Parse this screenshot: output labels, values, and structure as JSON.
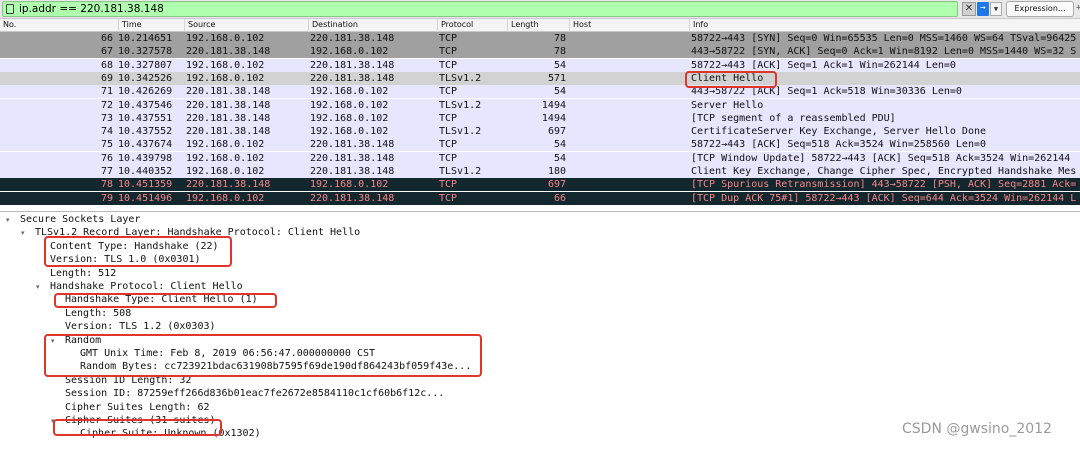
{
  "filter": {
    "value": "ip.addr == 220.181.38.148",
    "expression_label": "Expression...",
    "plus_label": "+"
  },
  "columns": [
    "No.",
    "Time",
    "Source",
    "Destination",
    "Protocol",
    "Length",
    "Host",
    "Info"
  ],
  "packets": [
    {
      "no": "66",
      "time": "10.214651",
      "src": "192.168.0.102",
      "dst": "220.181.38.148",
      "proto": "TCP",
      "len": "78",
      "host": "",
      "info": "58722→443 [SYN] Seq=0 Win=65535 Len=0 MSS=1460 WS=64 TSval=96425",
      "style": "gray"
    },
    {
      "no": "67",
      "time": "10.327578",
      "src": "220.181.38.148",
      "dst": "192.168.0.102",
      "proto": "TCP",
      "len": "78",
      "host": "",
      "info": "443→58722 [SYN, ACK] Seq=0 Ack=1 Win=8192 Len=0 MSS=1440 WS=32 S",
      "style": "gray"
    },
    {
      "no": "68",
      "time": "10.327807",
      "src": "192.168.0.102",
      "dst": "220.181.38.148",
      "proto": "TCP",
      "len": "54",
      "host": "",
      "info": "58722→443 [ACK] Seq=1 Ack=1 Win=262144 Len=0",
      "style": "lav"
    },
    {
      "no": "69",
      "time": "10.342526",
      "src": "192.168.0.102",
      "dst": "220.181.38.148",
      "proto": "TLSv1.2",
      "len": "571",
      "host": "",
      "info": "Client Hello",
      "style": "sel"
    },
    {
      "no": "71",
      "time": "10.426269",
      "src": "220.181.38.148",
      "dst": "192.168.0.102",
      "proto": "TCP",
      "len": "54",
      "host": "",
      "info": "443→58722 [ACK] Seq=1 Ack=518 Win=30336 Len=0",
      "style": "lav"
    },
    {
      "no": "72",
      "time": "10.437546",
      "src": "220.181.38.148",
      "dst": "192.168.0.102",
      "proto": "TLSv1.2",
      "len": "1494",
      "host": "",
      "info": "Server Hello",
      "style": "lav"
    },
    {
      "no": "73",
      "time": "10.437551",
      "src": "220.181.38.148",
      "dst": "192.168.0.102",
      "proto": "TCP",
      "len": "1494",
      "host": "",
      "info": "[TCP segment of a reassembled PDU]",
      "style": "lav"
    },
    {
      "no": "74",
      "time": "10.437552",
      "src": "220.181.38.148",
      "dst": "192.168.0.102",
      "proto": "TLSv1.2",
      "len": "697",
      "host": "",
      "info": "CertificateServer Key Exchange, Server Hello Done",
      "style": "lav"
    },
    {
      "no": "75",
      "time": "10.437674",
      "src": "192.168.0.102",
      "dst": "220.181.38.148",
      "proto": "TCP",
      "len": "54",
      "host": "",
      "info": "58722→443 [ACK] Seq=518 Ack=3524 Win=258560 Len=0",
      "style": "lav"
    },
    {
      "no": "76",
      "time": "10.439798",
      "src": "192.168.0.102",
      "dst": "220.181.38.148",
      "proto": "TCP",
      "len": "54",
      "host": "",
      "info": "[TCP Window Update] 58722→443 [ACK] Seq=518 Ack=3524 Win=262144",
      "style": "lav"
    },
    {
      "no": "77",
      "time": "10.440352",
      "src": "192.168.0.102",
      "dst": "220.181.38.148",
      "proto": "TLSv1.2",
      "len": "180",
      "host": "",
      "info": "Client Key Exchange, Change Cipher Spec, Encrypted Handshake Mes",
      "style": "lav"
    },
    {
      "no": "78",
      "time": "10.451359",
      "src": "220.181.38.148",
      "dst": "192.168.0.102",
      "proto": "TCP",
      "len": "697",
      "host": "",
      "info": "[TCP Spurious Retransmission] 443→58722 [PSH, ACK] Seq=2881 Ack=",
      "style": "dark"
    },
    {
      "no": "79",
      "time": "10.451496",
      "src": "192.168.0.102",
      "dst": "220.181.38.148",
      "proto": "TCP",
      "len": "66",
      "host": "",
      "info": "[TCP Dup ACK 75#1] 58722→443 [ACK] Seq=644 Ack=3524 Win=262144 L",
      "style": "dark"
    }
  ],
  "details": [
    {
      "text": "Secure Sockets Layer",
      "indent": 0,
      "arrow": "open"
    },
    {
      "text": "TLSv1.2 Record Layer: Handshake Protocol: Client Hello",
      "indent": 1,
      "arrow": "open"
    },
    {
      "text": "Content Type: Handshake (22)",
      "indent": 2,
      "arrow": ""
    },
    {
      "text": "Version: TLS 1.0 (0x0301)",
      "indent": 2,
      "arrow": ""
    },
    {
      "text": "Length: 512",
      "indent": 2,
      "arrow": ""
    },
    {
      "text": "Handshake Protocol: Client Hello",
      "indent": 2,
      "arrow": "open"
    },
    {
      "text": "Handshake Type: Client Hello (1)",
      "indent": 3,
      "arrow": ""
    },
    {
      "text": "Length: 508",
      "indent": 3,
      "arrow": ""
    },
    {
      "text": "Version: TLS 1.2 (0x0303)",
      "indent": 3,
      "arrow": ""
    },
    {
      "text": "Random",
      "indent": 3,
      "arrow": "open"
    },
    {
      "text": "GMT Unix Time: Feb  8, 2019 06:56:47.000000000 CST",
      "indent": 4,
      "arrow": ""
    },
    {
      "text": "Random Bytes: cc723921bdac631908b7595f69de190df864243bf059f43e...",
      "indent": 4,
      "arrow": ""
    },
    {
      "text": "Session ID Length: 32",
      "indent": 3,
      "arrow": ""
    },
    {
      "text": "Session ID: 87259eff266d836b01eac7fe2672e8584110c1cf60b6f12c...",
      "indent": 3,
      "arrow": ""
    },
    {
      "text": "Cipher Suites Length: 62",
      "indent": 3,
      "arrow": ""
    },
    {
      "text": "Cipher Suites (31 suites)",
      "indent": 3,
      "arrow": "open"
    },
    {
      "text": "Cipher Suite: Unknown (0x1302)",
      "indent": 4,
      "arrow": ""
    }
  ],
  "watermark": "CSDN @gwsino_2012",
  "colors": {
    "filter_bg": "#afffaf",
    "highlight": "#e0342c",
    "dark_row_bg": "#12272e",
    "dark_row_fg": "#f78787",
    "lavender": "#e7e6ff",
    "gray_row": "#a0a0a0"
  }
}
